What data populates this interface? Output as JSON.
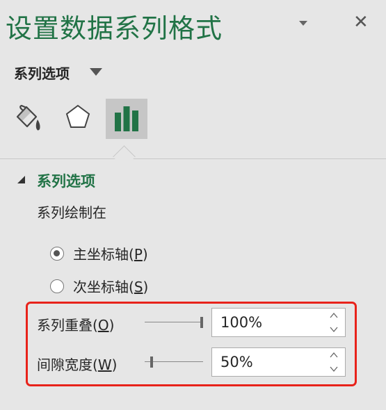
{
  "pane": {
    "title": "设置数据系列格式"
  },
  "options_dropdown": {
    "label": "系列选项"
  },
  "icon_tabs": [
    {
      "icon": "fill-bucket-icon",
      "selected": false
    },
    {
      "icon": "pentagon-effects-icon",
      "selected": false
    },
    {
      "icon": "bar-chart-icon",
      "selected": true
    }
  ],
  "section": {
    "title": "系列选项",
    "plot_on_label": "系列绘制在",
    "radios": [
      {
        "text": "主坐标轴(",
        "key": "P",
        "tail": ")",
        "checked": true
      },
      {
        "text": "次坐标轴(",
        "key": "S",
        "tail": ")",
        "checked": false
      }
    ]
  },
  "controls": {
    "overlap": {
      "text": "系列重叠(",
      "key": "O",
      "tail": ")",
      "value": "100%",
      "slider_fraction": 1.0
    },
    "gap_width": {
      "text": "间隙宽度(",
      "key": "W",
      "tail": ")",
      "value": "50%",
      "slider_fraction": 0.1
    }
  },
  "colors": {
    "accent": "#217346",
    "highlight": "#e8231b"
  }
}
